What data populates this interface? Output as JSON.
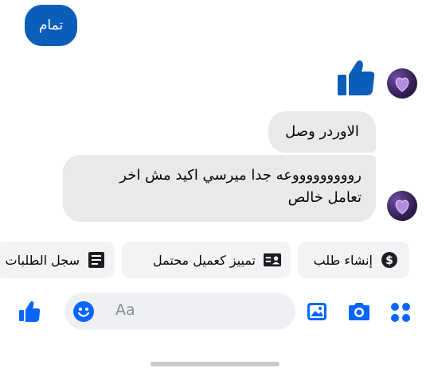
{
  "messages": {
    "outgoing": {
      "text": "تمام"
    },
    "incoming": [
      {
        "text": "الاوردر وصل"
      },
      {
        "line1": "روووووووووعه جدا ميرسي اكيد مش اخر",
        "line2": "تعامل خالص"
      }
    ],
    "reaction_icon": "thumbs-up-icon"
  },
  "quick_actions": [
    {
      "label": "إنشاء طلب",
      "icon": "dollar-circle-icon"
    },
    {
      "label": "تمييز كعميل محتمل",
      "icon": "contact-card-icon"
    },
    {
      "label": "سجل الطلبات",
      "icon": "order-list-icon"
    }
  ],
  "composer": {
    "placeholder": "Aa",
    "icons": [
      "like-icon",
      "emoji-icon",
      "gallery-icon",
      "camera-icon",
      "apps-grid-icon"
    ]
  },
  "colors": {
    "accent": "#0a5db8",
    "messenger_blue": "#0866ff",
    "bubble_gray": "#e9e9eb"
  }
}
